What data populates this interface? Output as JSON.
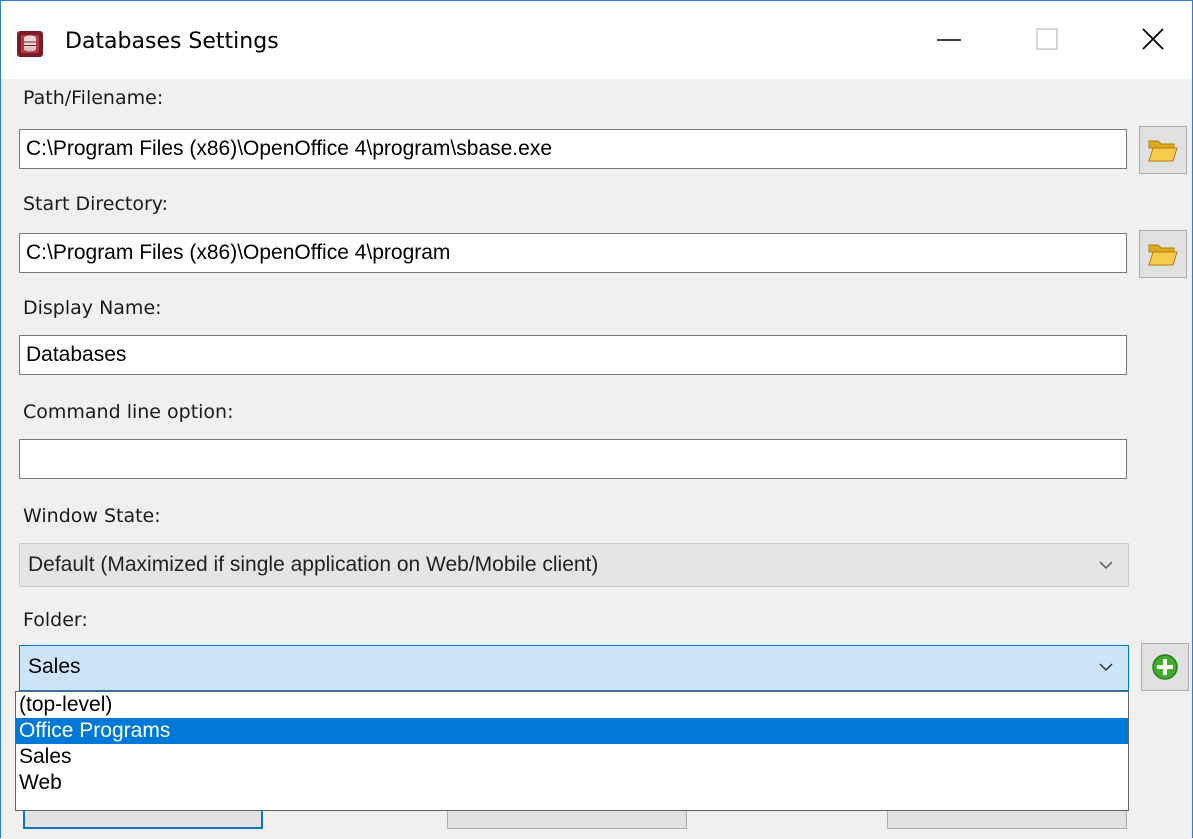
{
  "window": {
    "title": "Databases Settings"
  },
  "form": {
    "path_label": "Path/Filename:",
    "path_value": "C:\\Program Files (x86)\\OpenOffice 4\\program\\sbase.exe",
    "start_dir_label": "Start Directory:",
    "start_dir_value": "C:\\Program Files (x86)\\OpenOffice 4\\program",
    "display_name_label": "Display Name:",
    "display_name_value": "Databases",
    "cmd_label": "Command line option:",
    "cmd_value": "",
    "window_state_label": "Window State:",
    "window_state_value": "Default (Maximized if single application on Web/Mobile client)",
    "folder_label": "Folder:",
    "folder_value": "Sales"
  },
  "folder_options": [
    {
      "label": "(top-level)",
      "highlighted": false
    },
    {
      "label": "Office Programs",
      "highlighted": true
    },
    {
      "label": "Sales",
      "highlighted": false
    },
    {
      "label": "Web",
      "highlighted": false
    }
  ],
  "icons": {
    "app": "app-database-icon",
    "browse": "folder-open-icon",
    "add": "plus-circle-icon",
    "dropdown": "chevron-down-icon"
  },
  "colors": {
    "accent": "#0078d7",
    "selected_text": "#ffffff",
    "add_green": "#3fae29"
  }
}
